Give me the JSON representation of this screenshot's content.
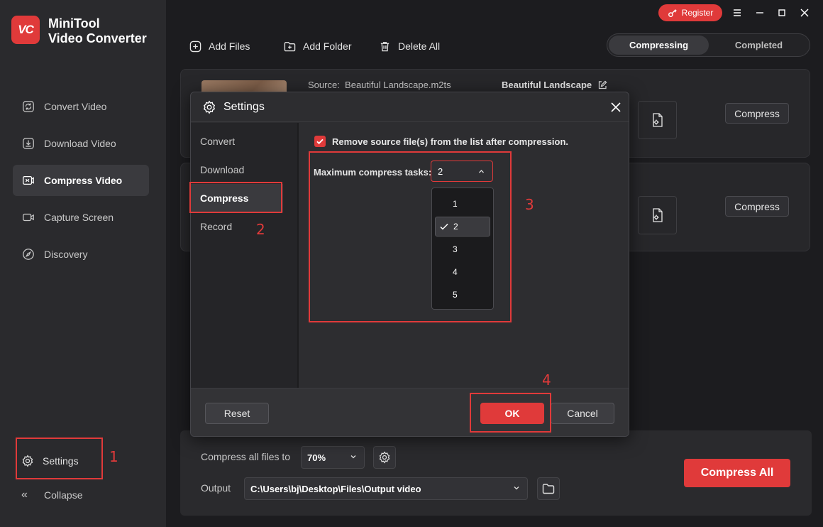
{
  "app": {
    "name_line1": "MiniTool",
    "name_line2": "Video Converter",
    "logo_text": "VC"
  },
  "sidebar": {
    "items": [
      {
        "label": "Convert Video",
        "icon": "convert-icon"
      },
      {
        "label": "Download Video",
        "icon": "download-icon"
      },
      {
        "label": "Compress Video",
        "icon": "compress-icon",
        "active": true
      },
      {
        "label": "Capture Screen",
        "icon": "camera-icon"
      },
      {
        "label": "Discovery",
        "icon": "compass-icon"
      }
    ],
    "settings_label": "Settings",
    "collapse_label": "Collapse",
    "collapse_glyph": "«"
  },
  "topbar": {
    "register_label": "Register"
  },
  "toolbar": {
    "add_files": "Add Files",
    "add_folder": "Add Folder",
    "delete_all": "Delete All"
  },
  "tabs": [
    {
      "label": "Compressing",
      "active": true
    },
    {
      "label": "Completed"
    }
  ],
  "files": [
    {
      "source_label": "Source:",
      "source_name": "Beautiful Landscape.m2ts",
      "target_name": "Beautiful Landscape",
      "compress_label": "Compress"
    },
    {
      "source_label": "",
      "source_name": "",
      "target_name": "",
      "compress_label": "Compress"
    }
  ],
  "bottom": {
    "compress_all_files_label": "Compress all files to",
    "percent_value": "70%",
    "output_label": "Output",
    "output_path": "C:\\Users\\bj\\Desktop\\Files\\Output video",
    "compress_all_label": "Compress All"
  },
  "dialog": {
    "title": "Settings",
    "nav": [
      {
        "label": "Convert"
      },
      {
        "label": "Download"
      },
      {
        "label": "Compress",
        "active": true
      },
      {
        "label": "Record"
      }
    ],
    "remove_source_label": "Remove source file(s) from the list after compression.",
    "remove_source_checked": true,
    "max_tasks_label": "Maximum compress tasks:",
    "max_tasks_value": "2",
    "max_tasks_options": [
      "1",
      "2",
      "3",
      "4",
      "5"
    ],
    "reset_label": "Reset",
    "ok_label": "OK",
    "cancel_label": "Cancel"
  },
  "annotations": [
    "1",
    "2",
    "3",
    "4"
  ],
  "colors": {
    "accent": "#e03a3a",
    "bg": "#1c1c1f",
    "sidebar": "#2a2a2d"
  }
}
